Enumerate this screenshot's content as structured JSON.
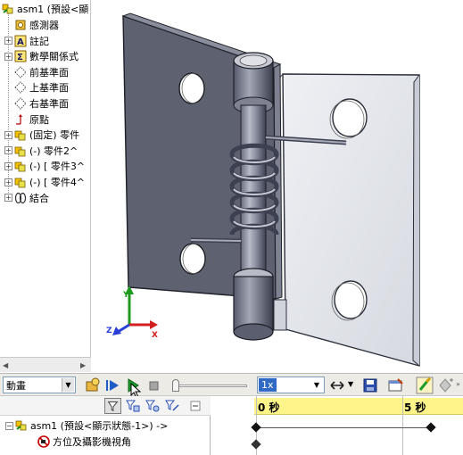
{
  "tree": {
    "root_label": "asm1 (預設<顯",
    "items": [
      {
        "label": "感測器",
        "icon": "sensor-icon",
        "expand": ""
      },
      {
        "label": "註記",
        "icon": "annotation-icon",
        "expand": "+"
      },
      {
        "label": "數學關係式",
        "icon": "equation-icon",
        "expand": "+"
      },
      {
        "label": "前基準面",
        "icon": "plane-icon",
        "expand": ""
      },
      {
        "label": "上基準面",
        "icon": "plane-icon",
        "expand": ""
      },
      {
        "label": "右基準面",
        "icon": "plane-icon",
        "expand": ""
      },
      {
        "label": "原點",
        "icon": "origin-icon",
        "expand": ""
      },
      {
        "label": "(固定) 零件",
        "icon": "part-icon",
        "expand": "+"
      },
      {
        "label": "(-) 零件2^",
        "icon": "part-icon",
        "expand": "+"
      },
      {
        "label": "(-) [ 零件3^",
        "icon": "part-icon",
        "expand": "+"
      },
      {
        "label": "(-) [ 零件4^",
        "icon": "part-icon",
        "expand": "+"
      },
      {
        "label": "結合",
        "icon": "mates-icon",
        "expand": "+"
      }
    ]
  },
  "viewport": {
    "triad": {
      "x": "X",
      "y": "Y",
      "z": "Z"
    }
  },
  "toolbar": {
    "study_type": "動畫",
    "speed": "1x"
  },
  "motion": {
    "root_label": "asm1 (預設<顯示狀態-1>) ->",
    "items": [
      {
        "label": "方位及攝影機視角",
        "icon": "orientation-camera-icon"
      }
    ],
    "time_labels": [
      "0 秒",
      "5 秒"
    ]
  },
  "colors": {
    "plate_dark": "#5d6170",
    "plate_glass": "#e4e6ea",
    "timeline_bar": "#fdf58a",
    "play_green": "#1a9c2a",
    "accent_blue": "#316ac5"
  }
}
